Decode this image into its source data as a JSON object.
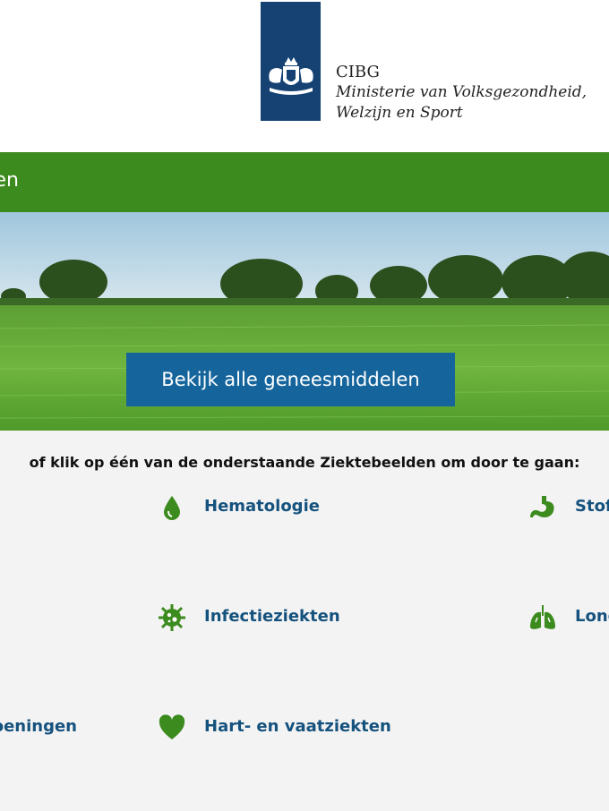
{
  "header": {
    "org_abbr": "CIBG",
    "ministry_line1": "Ministerie van Volksgezondheid,",
    "ministry_line2": "Welzijn en Sport",
    "logo_color": "#154273"
  },
  "nav": {
    "partial_text": "en",
    "color": "#3c8b1e"
  },
  "hero": {
    "cta_label": "Bekijk alle geneesmiddelen",
    "cta_color": "#15659c"
  },
  "intro_text": "of klik op één van de onderstaande Ziektebeelden om door te gaan:",
  "categories": [
    {
      "label": "Hematologie",
      "icon": "blood-drop-icon"
    },
    {
      "label": "Infectieziekten",
      "icon": "virus-icon"
    },
    {
      "label": "Hart- en vaatziekten",
      "icon": "heart-icon"
    },
    {
      "label": "Stof",
      "icon": "stomach-icon"
    },
    {
      "label": "Long",
      "icon": "lungs-icon"
    },
    {
      "label": "oeningen",
      "icon": ""
    }
  ],
  "accent_green": "#3c8b1e"
}
